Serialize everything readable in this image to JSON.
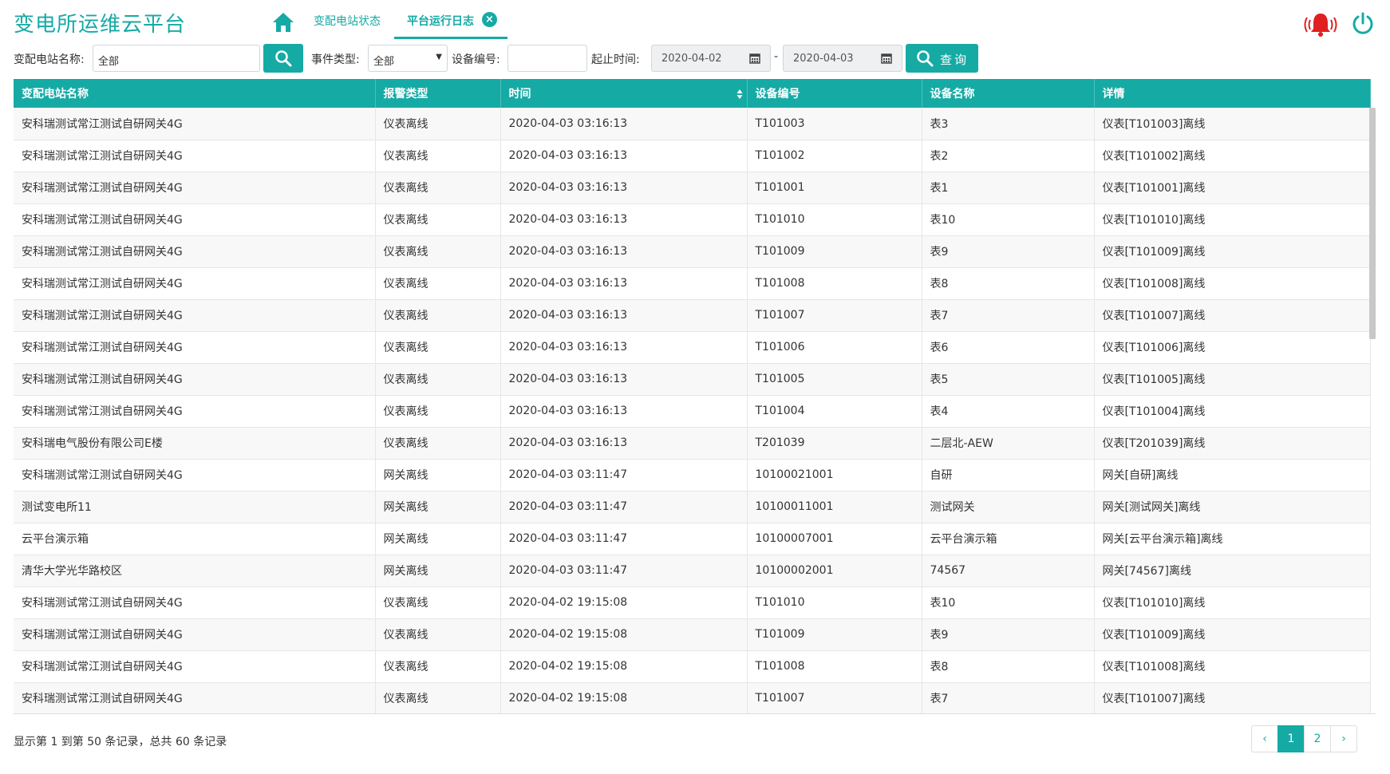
{
  "app": {
    "title": "变电所运维云平台"
  },
  "tabs": [
    {
      "label": "变配电站状态"
    },
    {
      "label": "平台运行日志"
    }
  ],
  "filters": {
    "station_label": "变配电站名称:",
    "station_value": "全部",
    "event_label": "事件类型:",
    "event_value": "全部",
    "device_no_label": "设备编号:",
    "device_no_value": "",
    "time_label": "起止时间:",
    "start_date": "2020-04-02",
    "date_sep": "-",
    "end_date": "2020-04-03",
    "query_label": "查询"
  },
  "table": {
    "headers": [
      "变配电站名称",
      "报警类型",
      "时间",
      "设备编号",
      "设备名称",
      "详情"
    ],
    "rows": [
      [
        "安科瑞测试常江测试自研网关4G",
        "仪表离线",
        "2020-04-03 03:16:13",
        "T101003",
        "表3",
        "仪表[T101003]离线"
      ],
      [
        "安科瑞测试常江测试自研网关4G",
        "仪表离线",
        "2020-04-03 03:16:13",
        "T101002",
        "表2",
        "仪表[T101002]离线"
      ],
      [
        "安科瑞测试常江测试自研网关4G",
        "仪表离线",
        "2020-04-03 03:16:13",
        "T101001",
        "表1",
        "仪表[T101001]离线"
      ],
      [
        "安科瑞测试常江测试自研网关4G",
        "仪表离线",
        "2020-04-03 03:16:13",
        "T101010",
        "表10",
        "仪表[T101010]离线"
      ],
      [
        "安科瑞测试常江测试自研网关4G",
        "仪表离线",
        "2020-04-03 03:16:13",
        "T101009",
        "表9",
        "仪表[T101009]离线"
      ],
      [
        "安科瑞测试常江测试自研网关4G",
        "仪表离线",
        "2020-04-03 03:16:13",
        "T101008",
        "表8",
        "仪表[T101008]离线"
      ],
      [
        "安科瑞测试常江测试自研网关4G",
        "仪表离线",
        "2020-04-03 03:16:13",
        "T101007",
        "表7",
        "仪表[T101007]离线"
      ],
      [
        "安科瑞测试常江测试自研网关4G",
        "仪表离线",
        "2020-04-03 03:16:13",
        "T101006",
        "表6",
        "仪表[T101006]离线"
      ],
      [
        "安科瑞测试常江测试自研网关4G",
        "仪表离线",
        "2020-04-03 03:16:13",
        "T101005",
        "表5",
        "仪表[T101005]离线"
      ],
      [
        "安科瑞测试常江测试自研网关4G",
        "仪表离线",
        "2020-04-03 03:16:13",
        "T101004",
        "表4",
        "仪表[T101004]离线"
      ],
      [
        "安科瑞电气股份有限公司E楼",
        "仪表离线",
        "2020-04-03 03:16:13",
        "T201039",
        "二层北-AEW",
        "仪表[T201039]离线"
      ],
      [
        "安科瑞测试常江测试自研网关4G",
        "网关离线",
        "2020-04-03 03:11:47",
        "10100021001",
        "自研",
        "网关[自研]离线"
      ],
      [
        "测试变电所11",
        "网关离线",
        "2020-04-03 03:11:47",
        "10100011001",
        "测试网关",
        "网关[测试网关]离线"
      ],
      [
        "云平台演示箱",
        "网关离线",
        "2020-04-03 03:11:47",
        "10100007001",
        "云平台演示箱",
        "网关[云平台演示箱]离线"
      ],
      [
        "清华大学光华路校区",
        "网关离线",
        "2020-04-03 03:11:47",
        "10100002001",
        "74567",
        "网关[74567]离线"
      ],
      [
        "安科瑞测试常江测试自研网关4G",
        "仪表离线",
        "2020-04-02 19:15:08",
        "T101010",
        "表10",
        "仪表[T101010]离线"
      ],
      [
        "安科瑞测试常江测试自研网关4G",
        "仪表离线",
        "2020-04-02 19:15:08",
        "T101009",
        "表9",
        "仪表[T101009]离线"
      ],
      [
        "安科瑞测试常江测试自研网关4G",
        "仪表离线",
        "2020-04-02 19:15:08",
        "T101008",
        "表8",
        "仪表[T101008]离线"
      ],
      [
        "安科瑞测试常江测试自研网关4G",
        "仪表离线",
        "2020-04-02 19:15:08",
        "T101007",
        "表7",
        "仪表[T101007]离线"
      ]
    ]
  },
  "pagination": {
    "summary": "显示第 1 到第 50 条记录，总共 60 条记录",
    "prev": "‹",
    "pages": [
      "1",
      "2"
    ],
    "next": "›",
    "current": "1"
  },
  "icons": {
    "home": "home-icon",
    "close": "close-icon",
    "search": "search-icon",
    "calendar": "calendar-icon",
    "sort": "sort-icon",
    "alarm": "bell-alarm-icon",
    "power": "power-icon"
  },
  "colors": {
    "accent": "#16aaa5",
    "alarm": "#e02020"
  }
}
